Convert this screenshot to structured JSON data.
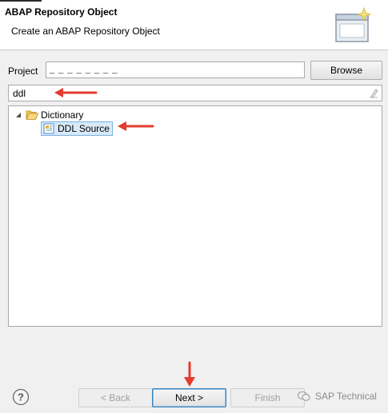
{
  "header": {
    "title": "ABAP Repository Object",
    "subtitle": "Create an ABAP Repository Object",
    "image_icon": "wizard-window-sparkle-icon"
  },
  "project": {
    "label": "Project",
    "value": "_ _ _ _ _ _ _ _",
    "browse_label": "Browse"
  },
  "filter": {
    "value": "ddl",
    "clear_icon": "eraser-icon"
  },
  "tree": {
    "items": [
      {
        "label": "Dictionary",
        "icon": "folder-open-icon",
        "expanded": true
      },
      {
        "label": "DDL Source",
        "icon": "ddl-source-icon",
        "selected": true
      }
    ]
  },
  "footer": {
    "help_icon": "help-icon",
    "back_label": "< Back",
    "next_label": "Next >",
    "finish_label": "Finish",
    "watermark": "SAP Technical"
  },
  "colors": {
    "annotation_arrow": "#e23b2e",
    "selection_bg": "#d8e9f8",
    "selection_border": "#7ab1e3"
  }
}
